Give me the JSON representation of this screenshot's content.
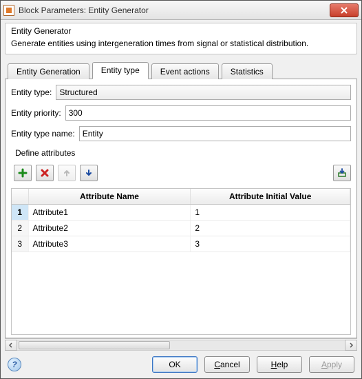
{
  "window": {
    "title": "Block Parameters: Entity Generator"
  },
  "description": {
    "heading": "Entity Generator",
    "text": "Generate entities using intergeneration times from signal or statistical distribution."
  },
  "tabs": [
    {
      "label": "Entity Generation",
      "active": false
    },
    {
      "label": "Entity type",
      "active": true
    },
    {
      "label": "Event actions",
      "active": false
    },
    {
      "label": "Statistics",
      "active": false
    }
  ],
  "fields": {
    "entity_type": {
      "label": "Entity type:",
      "value": "Structured"
    },
    "entity_priority": {
      "label": "Entity priority:",
      "value": "300"
    },
    "entity_type_name": {
      "label": "Entity type name:",
      "value": "Entity"
    },
    "define_attributes_label": "Define attributes"
  },
  "table": {
    "headers": {
      "name": "Attribute Name",
      "value": "Attribute Initial Value"
    },
    "rows": [
      {
        "num": "1",
        "name": "Attribute1",
        "value": "1",
        "selected": true
      },
      {
        "num": "2",
        "name": "Attribute2",
        "value": "2",
        "selected": false
      },
      {
        "num": "3",
        "name": "Attribute3",
        "value": "3",
        "selected": false
      }
    ]
  },
  "buttons": {
    "ok": "OK",
    "cancel": "Cancel",
    "help": "Help",
    "apply": "Apply"
  }
}
